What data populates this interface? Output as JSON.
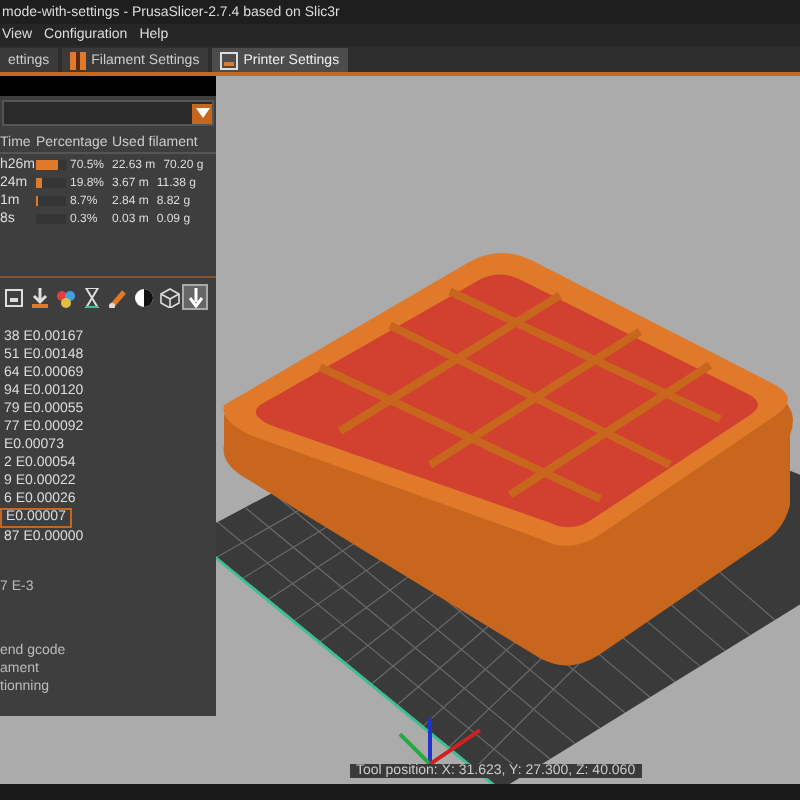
{
  "window": {
    "title": "mode-with-settings - PrusaSlicer-2.7.4 based on Slic3r"
  },
  "menu": [
    "View",
    "Configuration",
    "Help"
  ],
  "tabs": [
    {
      "label": "ettings",
      "kind": "plain",
      "selected": false
    },
    {
      "label": "Filament Settings",
      "kind": "filament",
      "selected": false
    },
    {
      "label": "Printer Settings",
      "kind": "printer",
      "selected": true
    }
  ],
  "legend": {
    "columns": [
      "Time",
      "Percentage",
      "Used filament"
    ],
    "rows": [
      {
        "time": "h26m",
        "level": 0.705,
        "percentage": "70.5%",
        "length": "22.63 m",
        "weight": "70.20 g"
      },
      {
        "time": "24m",
        "level": 0.198,
        "percentage": "19.8%",
        "length": "3.67 m",
        "weight": "11.38 g"
      },
      {
        "time": "1m",
        "level": 0.087,
        "percentage": "8.7%",
        "length": "2.84 m",
        "weight": "8.82 g"
      },
      {
        "time": "8s",
        "level": 0.003,
        "percentage": "0.3%",
        "length": "0.03 m",
        "weight": "0.09 g"
      }
    ]
  },
  "toolbar": [
    {
      "kind": "printer",
      "selected": false
    },
    {
      "kind": "download",
      "selected": false
    },
    {
      "kind": "colors",
      "selected": false
    },
    {
      "kind": "hourglass",
      "selected": false
    },
    {
      "kind": "brush",
      "selected": false
    },
    {
      "kind": "contrast",
      "selected": false
    },
    {
      "kind": "cube",
      "selected": false
    },
    {
      "kind": "arrow",
      "selected": true
    }
  ],
  "gcode": [
    {
      "text": "38 E0.00167",
      "selected": false
    },
    {
      "text": "51 E0.00148",
      "selected": false
    },
    {
      "text": "64 E0.00069",
      "selected": false
    },
    {
      "text": "94 E0.00120",
      "selected": false
    },
    {
      "text": "79 E0.00055",
      "selected": false
    },
    {
      "text": "77 E0.00092",
      "selected": false
    },
    {
      "text": "E0.00073",
      "selected": false
    },
    {
      "text": "2 E0.00054",
      "selected": false
    },
    {
      "text": "9 E0.00022",
      "selected": false
    },
    {
      "text": "6 E0.00026",
      "selected": false
    },
    {
      "text": "E0.00007",
      "selected": true
    },
    {
      "text": "87 E0.00000",
      "selected": false
    }
  ],
  "notes": [
    "7 E-3",
    "end gcode",
    "ament",
    "tionning"
  ],
  "status": "Tool position: X: 31.623, Y: 27.300, Z: 40.060"
}
